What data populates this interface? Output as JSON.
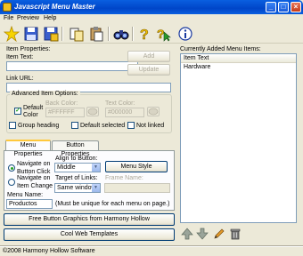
{
  "window": {
    "title": "Javascript Menu Master",
    "controls": [
      "_",
      "□",
      "×"
    ]
  },
  "menubar": {
    "items": [
      "File",
      "Preview",
      "Help"
    ]
  },
  "toolbar": {
    "icons": [
      "new-star-icon",
      "save-icon",
      "save-as-icon",
      "copy-icon",
      "paste-icon",
      "preview-binoculars-icon",
      "help-icon",
      "help-pointer-icon",
      "info-icon"
    ]
  },
  "item_properties": {
    "header": "Item Properties:",
    "item_text_label": "Item Text:",
    "item_text_value": "",
    "add_button": "Add",
    "update_button": "Update",
    "link_url_label": "Link URL:",
    "link_url_value": ""
  },
  "advanced": {
    "title": "Advanced Item Options:",
    "default_color_label": "Default\nColor",
    "default_color_checked": true,
    "back_color_label": "Back Color:",
    "back_color_value": "#FFFFFF",
    "text_color_label": "Text Color:",
    "text_color_value": "#000000",
    "group_heading_label": "Group heading",
    "default_selected_label": "Default selected",
    "not_linked_label": "Not linked"
  },
  "tabs": {
    "items": [
      "Menu Properties",
      "Button Properties"
    ],
    "active": 0
  },
  "menu_props": {
    "navigate_click_label": "Navigate on\nButton Click",
    "navigate_change_label": "Navigate on\nItem Change",
    "align_label": "Align to Button:",
    "align_value": "Middle",
    "menu_style_button": "Menu Style",
    "target_label": "Target of Links:",
    "target_value": "Same window",
    "frame_name_label": "Frame Name:",
    "frame_name_value": "",
    "menu_name_label": "Menu Name:",
    "menu_name_value": "Productos",
    "menu_name_hint": "(Must be unique for each menu on page.)"
  },
  "links": {
    "free_graphics": "Free Button Graphics from Harmony Hollow",
    "cool_templates": "Cool Web Templates"
  },
  "menu_items_panel": {
    "header": "Currently Added Menu Items:",
    "column": "Item Text",
    "rows": [
      "Hardware"
    ]
  },
  "bottom_icons": [
    "move-up-icon",
    "move-down-icon",
    "edit-pencil-icon",
    "delete-trash-icon"
  ],
  "status": {
    "text": "©2008 Harmony Hollow Software"
  },
  "colors": {
    "titlebar": "#0045c8",
    "window_bg": "#ece9d8",
    "accent_green": "#21a121"
  }
}
